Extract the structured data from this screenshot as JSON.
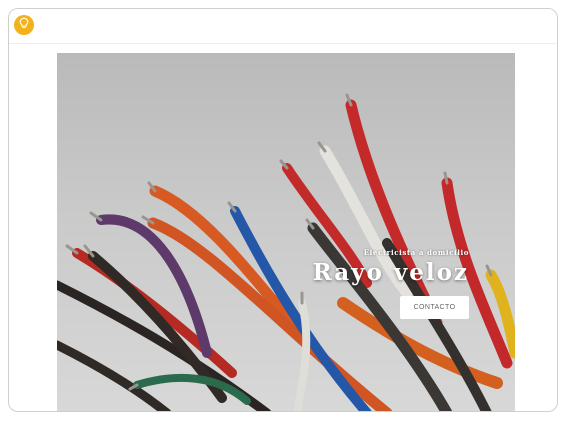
{
  "header": {
    "logo_icon": "lightbulb-icon",
    "logo_color": "#f2b21c"
  },
  "hero": {
    "subtitle": "Electricista a domicilio",
    "title": "Rayo veloz",
    "contact_button": "CONTACTO",
    "background_image": "colored-cables-photo"
  }
}
